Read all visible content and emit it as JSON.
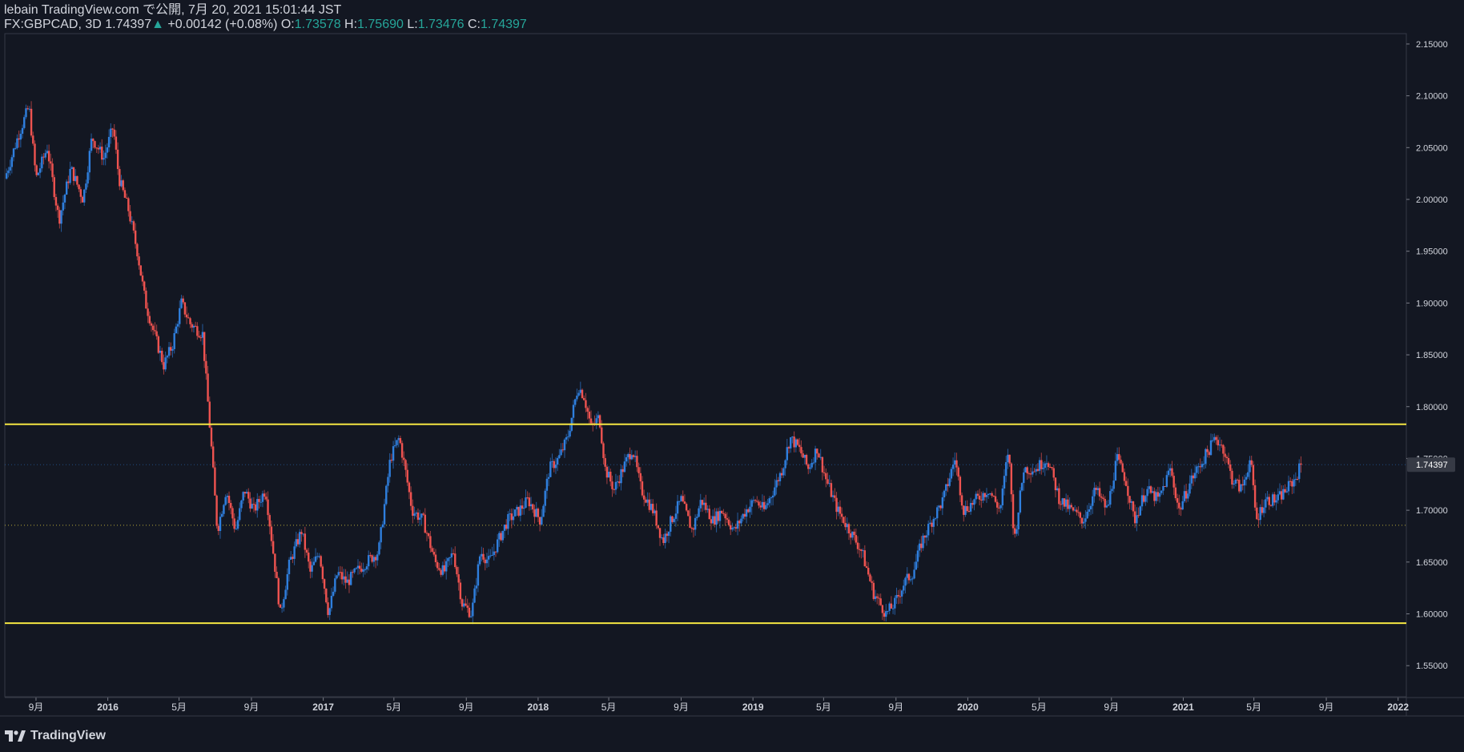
{
  "header": {
    "line1": "lebain TradingView.com で公開, 7月 20, 2021 15:01:44 JST",
    "symbol": "FX:GBPCAD, 3D",
    "last": "1.74397",
    "change_arrow": "▲",
    "change": "+0.00142 (+0.08%)",
    "o_label": "O:",
    "o_value": "1.73578",
    "h_label": "H:",
    "h_value": "1.75690",
    "l_label": "L:",
    "l_value": "1.73476",
    "c_label": "C:",
    "c_value": "1.74397"
  },
  "footer": {
    "brand": "TradingView"
  },
  "colors": {
    "background": "#131722",
    "up": "#2f7fde",
    "down": "#ef5350",
    "line": "#f5e642",
    "axis_text": "#d1d4dc",
    "grid": "#2a2e39"
  },
  "chart_data": {
    "type": "candlestick",
    "ylim": [
      1.52,
      2.16
    ],
    "yticks": [
      "2.15000",
      "2.10000",
      "2.05000",
      "2.00000",
      "1.95000",
      "1.90000",
      "1.85000",
      "1.80000",
      "1.75000",
      "1.70000",
      "1.65000",
      "1.60000",
      "1.55000"
    ],
    "ytick_values": [
      2.15,
      2.1,
      2.05,
      2.0,
      1.95,
      1.9,
      1.85,
      1.8,
      1.75,
      1.7,
      1.65,
      1.6,
      1.55
    ],
    "x_range": [
      "2015-07-10",
      "2022-01-15"
    ],
    "xticks": [
      {
        "label": "9月",
        "date": "2015-09-01"
      },
      {
        "label": "2016",
        "date": "2016-01-01"
      },
      {
        "label": "5月",
        "date": "2016-05-01"
      },
      {
        "label": "9月",
        "date": "2016-09-01"
      },
      {
        "label": "2017",
        "date": "2017-01-01"
      },
      {
        "label": "5月",
        "date": "2017-05-01"
      },
      {
        "label": "9月",
        "date": "2017-09-01"
      },
      {
        "label": "2018",
        "date": "2018-01-01"
      },
      {
        "label": "5月",
        "date": "2018-05-01"
      },
      {
        "label": "9月",
        "date": "2018-09-01"
      },
      {
        "label": "2019",
        "date": "2019-01-01"
      },
      {
        "label": "5月",
        "date": "2019-05-01"
      },
      {
        "label": "9月",
        "date": "2019-09-01"
      },
      {
        "label": "2020",
        "date": "2020-01-01"
      },
      {
        "label": "5月",
        "date": "2020-05-01"
      },
      {
        "label": "9月",
        "date": "2020-09-01"
      },
      {
        "label": "2021",
        "date": "2021-01-01"
      },
      {
        "label": "5月",
        "date": "2021-05-01"
      },
      {
        "label": "9月",
        "date": "2021-09-01"
      },
      {
        "label": "2022",
        "date": "2022-01-01"
      }
    ],
    "last_price_label": "1.74397",
    "last_price": 1.74397,
    "horizontal_lines": [
      1.783,
      1.591
    ],
    "dotted_line": 1.6855,
    "close_path": [
      [
        "2015-07-10",
        2.02
      ],
      [
        "2015-08-01",
        2.06
      ],
      [
        "2015-08-20",
        2.09
      ],
      [
        "2015-09-01",
        2.02
      ],
      [
        "2015-09-20",
        2.05
      ],
      [
        "2015-10-10",
        1.98
      ],
      [
        "2015-10-30",
        2.03
      ],
      [
        "2015-11-20",
        2.0
      ],
      [
        "2015-12-05",
        2.06
      ],
      [
        "2015-12-25",
        2.04
      ],
      [
        "2016-01-10",
        2.07
      ],
      [
        "2016-01-20",
        2.02
      ],
      [
        "2016-02-05",
        1.99
      ],
      [
        "2016-02-20",
        1.95
      ],
      [
        "2016-03-05",
        1.9
      ],
      [
        "2016-03-20",
        1.87
      ],
      [
        "2016-04-05",
        1.84
      ],
      [
        "2016-04-20",
        1.86
      ],
      [
        "2016-05-05",
        1.9
      ],
      [
        "2016-05-20",
        1.88
      ],
      [
        "2016-06-10",
        1.87
      ],
      [
        "2016-06-25",
        1.76
      ],
      [
        "2016-07-05",
        1.68
      ],
      [
        "2016-07-20",
        1.72
      ],
      [
        "2016-08-05",
        1.68
      ],
      [
        "2016-08-20",
        1.72
      ],
      [
        "2016-09-05",
        1.7
      ],
      [
        "2016-09-25",
        1.72
      ],
      [
        "2016-10-10",
        1.65
      ],
      [
        "2016-10-20",
        1.6
      ],
      [
        "2016-11-05",
        1.65
      ],
      [
        "2016-11-25",
        1.68
      ],
      [
        "2016-12-10",
        1.64
      ],
      [
        "2016-12-25",
        1.66
      ],
      [
        "2017-01-10",
        1.6
      ],
      [
        "2017-01-25",
        1.64
      ],
      [
        "2017-02-10",
        1.63
      ],
      [
        "2017-02-25",
        1.64
      ],
      [
        "2017-03-15",
        1.65
      ],
      [
        "2017-04-05",
        1.66
      ],
      [
        "2017-04-25",
        1.75
      ],
      [
        "2017-05-10",
        1.77
      ],
      [
        "2017-05-20",
        1.74
      ],
      [
        "2017-06-01",
        1.7
      ],
      [
        "2017-06-20",
        1.69
      ],
      [
        "2017-07-10",
        1.65
      ],
      [
        "2017-07-25",
        1.64
      ],
      [
        "2017-08-10",
        1.66
      ],
      [
        "2017-08-25",
        1.61
      ],
      [
        "2017-09-10",
        1.6
      ],
      [
        "2017-09-25",
        1.66
      ],
      [
        "2017-10-10",
        1.65
      ],
      [
        "2017-10-25",
        1.67
      ],
      [
        "2017-11-10",
        1.69
      ],
      [
        "2017-11-30",
        1.7
      ],
      [
        "2017-12-15",
        1.71
      ],
      [
        "2018-01-05",
        1.69
      ],
      [
        "2018-01-20",
        1.74
      ],
      [
        "2018-02-05",
        1.75
      ],
      [
        "2018-02-20",
        1.77
      ],
      [
        "2018-03-10",
        1.82
      ],
      [
        "2018-03-20",
        1.81
      ],
      [
        "2018-04-01",
        1.78
      ],
      [
        "2018-04-15",
        1.79
      ],
      [
        "2018-04-25",
        1.74
      ],
      [
        "2018-05-10",
        1.72
      ],
      [
        "2018-05-25",
        1.74
      ],
      [
        "2018-06-10",
        1.76
      ],
      [
        "2018-06-25",
        1.72
      ],
      [
        "2018-07-15",
        1.7
      ],
      [
        "2018-08-01",
        1.67
      ],
      [
        "2018-08-15",
        1.69
      ],
      [
        "2018-09-01",
        1.71
      ],
      [
        "2018-09-20",
        1.68
      ],
      [
        "2018-10-05",
        1.71
      ],
      [
        "2018-10-25",
        1.69
      ],
      [
        "2018-11-10",
        1.7
      ],
      [
        "2018-11-30",
        1.68
      ],
      [
        "2018-12-20",
        1.7
      ],
      [
        "2019-01-05",
        1.71
      ],
      [
        "2019-01-20",
        1.7
      ],
      [
        "2019-02-05",
        1.72
      ],
      [
        "2019-02-20",
        1.74
      ],
      [
        "2019-03-05",
        1.77
      ],
      [
        "2019-03-20",
        1.76
      ],
      [
        "2019-04-05",
        1.74
      ],
      [
        "2019-04-20",
        1.76
      ],
      [
        "2019-05-05",
        1.73
      ],
      [
        "2019-05-25",
        1.7
      ],
      [
        "2019-06-15",
        1.68
      ],
      [
        "2019-07-05",
        1.66
      ],
      [
        "2019-07-25",
        1.62
      ],
      [
        "2019-08-15",
        1.6
      ],
      [
        "2019-08-30",
        1.61
      ],
      [
        "2019-09-15",
        1.63
      ],
      [
        "2019-09-30",
        1.64
      ],
      [
        "2019-10-15",
        1.67
      ],
      [
        "2019-11-01",
        1.69
      ],
      [
        "2019-11-20",
        1.71
      ],
      [
        "2019-12-10",
        1.75
      ],
      [
        "2019-12-25",
        1.7
      ],
      [
        "2020-01-15",
        1.71
      ],
      [
        "2020-02-05",
        1.72
      ],
      [
        "2020-02-25",
        1.7
      ],
      [
        "2020-03-10",
        1.76
      ],
      [
        "2020-03-20",
        1.67
      ],
      [
        "2020-04-05",
        1.74
      ],
      [
        "2020-04-25",
        1.74
      ],
      [
        "2020-05-15",
        1.75
      ],
      [
        "2020-06-05",
        1.71
      ],
      [
        "2020-06-25",
        1.7
      ],
      [
        "2020-07-15",
        1.69
      ],
      [
        "2020-08-05",
        1.72
      ],
      [
        "2020-08-25",
        1.7
      ],
      [
        "2020-09-10",
        1.75
      ],
      [
        "2020-09-25",
        1.73
      ],
      [
        "2020-10-10",
        1.69
      ],
      [
        "2020-10-30",
        1.72
      ],
      [
        "2020-11-20",
        1.71
      ],
      [
        "2020-12-10",
        1.74
      ],
      [
        "2020-12-25",
        1.7
      ],
      [
        "2021-01-15",
        1.73
      ],
      [
        "2021-02-05",
        1.75
      ],
      [
        "2021-02-25",
        1.77
      ],
      [
        "2021-03-10",
        1.76
      ],
      [
        "2021-03-25",
        1.73
      ],
      [
        "2021-04-10",
        1.72
      ],
      [
        "2021-04-25",
        1.75
      ],
      [
        "2021-05-05",
        1.69
      ],
      [
        "2021-05-20",
        1.71
      ],
      [
        "2021-06-10",
        1.71
      ],
      [
        "2021-06-25",
        1.72
      ],
      [
        "2021-07-10",
        1.73
      ],
      [
        "2021-07-20",
        1.74397
      ]
    ]
  }
}
